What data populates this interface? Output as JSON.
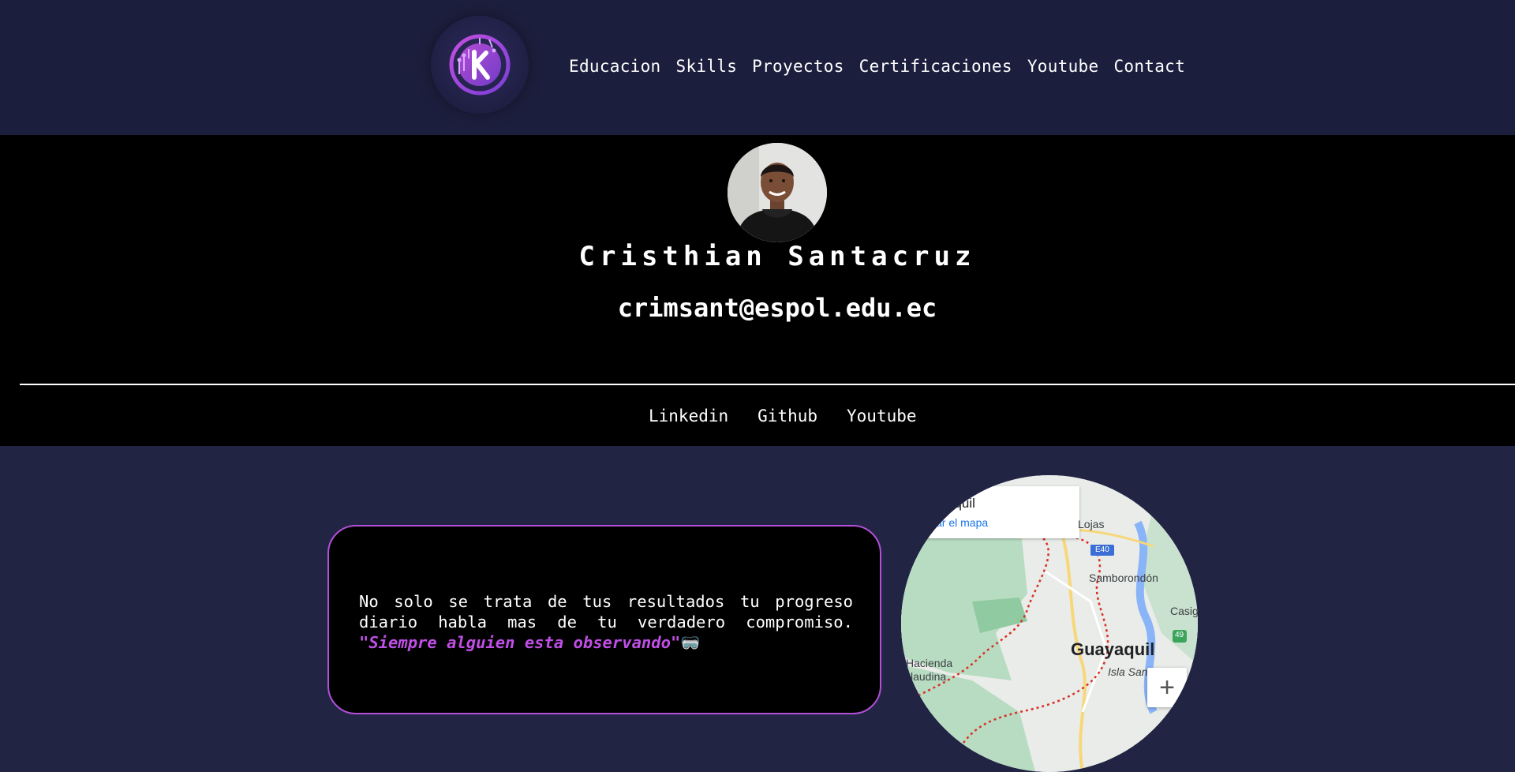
{
  "header": {
    "nav": [
      {
        "label": "Educacion"
      },
      {
        "label": "Skills"
      },
      {
        "label": "Proyectos"
      },
      {
        "label": "Certificaciones"
      },
      {
        "label": "Youtube"
      },
      {
        "label": "Contact"
      }
    ]
  },
  "profile": {
    "name": "Cristhian Santacruz",
    "email": "crimsant@espol.edu.ec",
    "social": [
      {
        "label": "Linkedin"
      },
      {
        "label": "Github"
      },
      {
        "label": "Youtube"
      }
    ]
  },
  "quote": {
    "text": "No solo se trata de tus resultados tu progreso diario habla mas de tu verdadero compromiso.",
    "highlight": "\"Siempre alguien esta observando\"",
    "emoji": "🥽"
  },
  "map": {
    "card_title": "aquil",
    "card_link": "pliar el mapa",
    "labels": {
      "lojas": "Lojas",
      "e40": "E40",
      "samborondon": "Samborondón",
      "casigu": "Casigu",
      "r49": "49",
      "guayaquil": "Guayaquil",
      "hacienda": "Hacienda",
      "claudina": "laudina",
      "isla_san": "Isla San"
    },
    "zoom_in": "+"
  },
  "colors": {
    "header_bg": "#1c1e3d",
    "page_bg": "#222444",
    "accent": "#b34fd9",
    "highlight": "#c04fe6"
  }
}
